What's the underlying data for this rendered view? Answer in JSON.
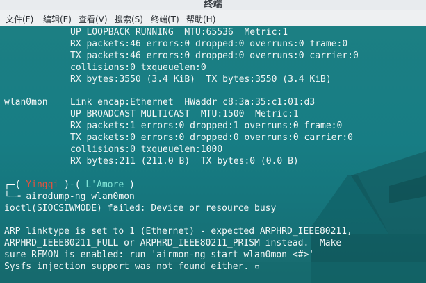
{
  "window": {
    "title": "终端"
  },
  "menu": [
    {
      "label": "文件(F)"
    },
    {
      "label": "编辑(E)"
    },
    {
      "label": "查看(V)"
    },
    {
      "label": "搜索(S)"
    },
    {
      "label": "终端(T)"
    },
    {
      "label": "帮助(H)"
    }
  ],
  "terminal": {
    "lo": [
      "UP LOOPBACK RUNNING  MTU:65536  Metric:1",
      "RX packets:46 errors:0 dropped:0 overruns:0 frame:0",
      "TX packets:46 errors:0 dropped:0 overruns:0 carrier:0",
      "collisions:0 txqueuelen:0",
      "RX bytes:3550 (3.4 KiB)  TX bytes:3550 (3.4 KiB)"
    ],
    "wlan_name": "wlan0mon",
    "wlan": [
      "Link encap:Ethernet  HWaddr c8:3a:35:c1:01:d3",
      "UP BROADCAST MULTICAST  MTU:1500  Metric:1",
      "RX packets:1 errors:0 dropped:1 overruns:0 frame:0",
      "TX packets:0 errors:0 dropped:0 overruns:0 carrier:0",
      "collisions:0 txqueuelen:1000",
      "RX bytes:211 (211.0 B)  TX bytes:0 (0.0 B)"
    ],
    "prompt": {
      "corner_top": "┌─(",
      "user": "Yingqi",
      "sep": ")-(",
      "host": "L'Amore",
      "close": ")",
      "corner_bottom": "└─╼",
      "command": "airodump-ng wlan0mon"
    },
    "output": [
      "ioctl(SIOCSIWMODE) failed: Device or resource busy",
      "",
      "ARP linktype is set to 1 (Ethernet) - expected ARPHRD_IEEE80211,",
      "ARPHRD_IEEE80211_FULL or ARPHRD_IEEE80211_PRISM instead.  Make",
      "sure RFMON is enabled: run 'airmon-ng start wlan0mon <#>'",
      "Sysfs injection support was not found either."
    ]
  }
}
